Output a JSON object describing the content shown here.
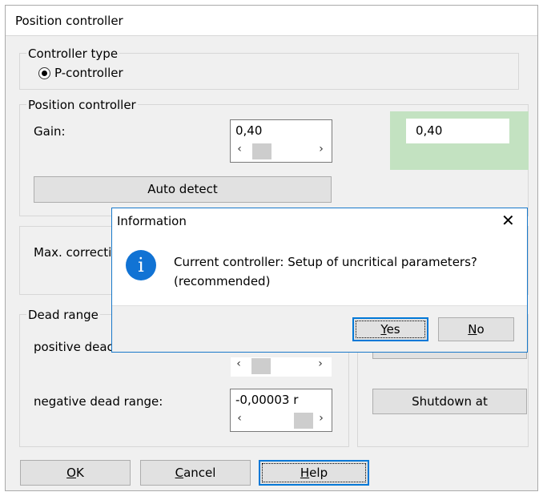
{
  "window": {
    "title": "Position controller"
  },
  "controller_type": {
    "legend": "Controller type",
    "option_label": "P-controller",
    "selected": true
  },
  "position_controller": {
    "legend": "Position controller",
    "gain_label": "Gain:",
    "gain_value": "0,40",
    "gain_display": "0,40",
    "auto_detect_label": "Auto detect"
  },
  "max_correction": {
    "label": "Max. correcti"
  },
  "dead_range": {
    "legend": "Dead range",
    "positive_label": "positive deac",
    "negative_label": "negative dead range:",
    "negative_value": "-0,00003 r",
    "shutdown_label": "Shutdown at"
  },
  "footer": {
    "ok_key": "O",
    "ok_rest": "K",
    "cancel_key": "C",
    "cancel_rest": "ancel",
    "help_key": "H",
    "help_rest": "elp"
  },
  "dialog": {
    "title": "Information",
    "close_glyph": "✕",
    "icon_glyph": "i",
    "message_line1": "Current controller: Setup of uncritical parameters?",
    "message_line2": "(recommended)",
    "yes_key": "Y",
    "yes_rest": "es",
    "no_key": "N",
    "no_rest": "o"
  },
  "glyphs": {
    "left": "‹",
    "right": "›"
  },
  "colors": {
    "accent": "#0078d7",
    "green_panel": "#c3e2c1",
    "info_blue": "#1173d4"
  }
}
